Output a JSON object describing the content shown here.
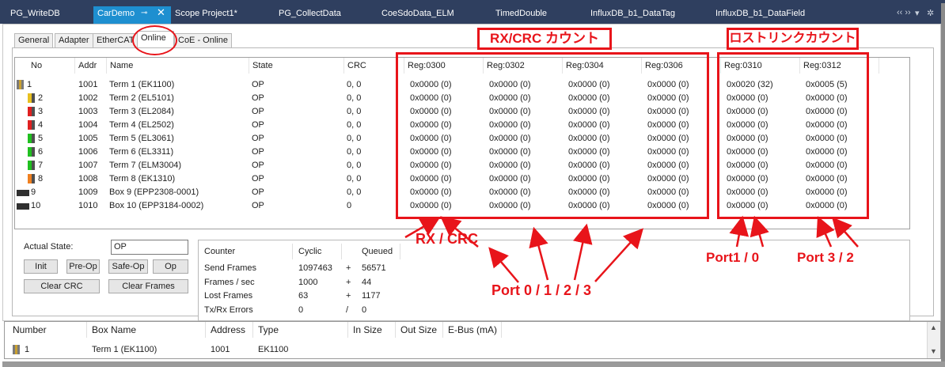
{
  "doc_tabs": [
    {
      "label": "PG_WriteDB",
      "active": false
    },
    {
      "label": "CarDemo",
      "active": true
    },
    {
      "label": "Scope Project1*",
      "active": false
    },
    {
      "label": "PG_CollectData",
      "active": false
    },
    {
      "label": "CoeSdoData_ELM",
      "active": false
    },
    {
      "label": "TimedDouble",
      "active": false
    },
    {
      "label": "InfluxDB_b1_DataTag",
      "active": false
    },
    {
      "label": "InfluxDB_b1_DataField",
      "active": false
    }
  ],
  "tab_controls": {
    "pin_glyph": "⊸",
    "close_glyph": "✕",
    "scroll_glyph": "‹‹ ››",
    "menu_glyph": "▾",
    "settings_glyph": "✲"
  },
  "sub_tabs": [
    "General",
    "Adapter",
    "EtherCAT",
    "Online",
    "CoE - Online"
  ],
  "selected_sub_tab": "Online",
  "grid": {
    "columns": [
      "No",
      "Addr",
      "Name",
      "State",
      "CRC",
      "Reg:0300",
      "Reg:0302",
      "Reg:0304",
      "Reg:0306",
      "Reg:0310",
      "Reg:0312"
    ],
    "rows": [
      {
        "no": "1",
        "addr": "1001",
        "name": "Term 1 (EK1100)",
        "state": "OP",
        "crc": "0, 0",
        "r0300": "0x0000 (0)",
        "r0302": "0x0000 (0)",
        "r0304": "0x0000 (0)",
        "r0306": "0x0000 (0)",
        "r0310": "0x0020 (32)",
        "r0312": "0x0005 (5)",
        "icon": "coupler-icon"
      },
      {
        "no": "2",
        "addr": "1002",
        "name": "Term 2 (EL5101)",
        "state": "OP",
        "crc": "0, 0",
        "r0300": "0x0000 (0)",
        "r0302": "0x0000 (0)",
        "r0304": "0x0000 (0)",
        "r0306": "0x0000 (0)",
        "r0310": "0x0000 (0)",
        "r0312": "0x0000 (0)",
        "icon": "terminal-yellow-icon"
      },
      {
        "no": "3",
        "addr": "1003",
        "name": "Term 3 (EL2084)",
        "state": "OP",
        "crc": "0, 0",
        "r0300": "0x0000 (0)",
        "r0302": "0x0000 (0)",
        "r0304": "0x0000 (0)",
        "r0306": "0x0000 (0)",
        "r0310": "0x0000 (0)",
        "r0312": "0x0000 (0)",
        "icon": "terminal-red-icon"
      },
      {
        "no": "4",
        "addr": "1004",
        "name": "Term 4 (EL2502)",
        "state": "OP",
        "crc": "0, 0",
        "r0300": "0x0000 (0)",
        "r0302": "0x0000 (0)",
        "r0304": "0x0000 (0)",
        "r0306": "0x0000 (0)",
        "r0310": "0x0000 (0)",
        "r0312": "0x0000 (0)",
        "icon": "terminal-red-icon"
      },
      {
        "no": "5",
        "addr": "1005",
        "name": "Term 5 (EL3061)",
        "state": "OP",
        "crc": "0, 0",
        "r0300": "0x0000 (0)",
        "r0302": "0x0000 (0)",
        "r0304": "0x0000 (0)",
        "r0306": "0x0000 (0)",
        "r0310": "0x0000 (0)",
        "r0312": "0x0000 (0)",
        "icon": "terminal-green-icon"
      },
      {
        "no": "6",
        "addr": "1006",
        "name": "Term 6 (EL3311)",
        "state": "OP",
        "crc": "0, 0",
        "r0300": "0x0000 (0)",
        "r0302": "0x0000 (0)",
        "r0304": "0x0000 (0)",
        "r0306": "0x0000 (0)",
        "r0310": "0x0000 (0)",
        "r0312": "0x0000 (0)",
        "icon": "terminal-green-icon"
      },
      {
        "no": "7",
        "addr": "1007",
        "name": "Term 7 (ELM3004)",
        "state": "OP",
        "crc": "0, 0",
        "r0300": "0x0000 (0)",
        "r0302": "0x0000 (0)",
        "r0304": "0x0000 (0)",
        "r0306": "0x0000 (0)",
        "r0310": "0x0000 (0)",
        "r0312": "0x0000 (0)",
        "icon": "terminal-green-icon"
      },
      {
        "no": "8",
        "addr": "1008",
        "name": "Term 8 (EK1310)",
        "state": "OP",
        "crc": "0, 0",
        "r0300": "0x0000 (0)",
        "r0302": "0x0000 (0)",
        "r0304": "0x0000 (0)",
        "r0306": "0x0000 (0)",
        "r0310": "0x0000 (0)",
        "r0312": "0x0000 (0)",
        "icon": "terminal-orange-icon"
      },
      {
        "no": "9",
        "addr": "1009",
        "name": "Box 9 (EPP2308-0001)",
        "state": "OP",
        "crc": "0, 0",
        "r0300": "0x0000 (0)",
        "r0302": "0x0000 (0)",
        "r0304": "0x0000 (0)",
        "r0306": "0x0000 (0)",
        "r0310": "0x0000 (0)",
        "r0312": "0x0000 (0)",
        "icon": "box-icon"
      },
      {
        "no": "10",
        "addr": "1010",
        "name": "Box 10 (EPP3184-0002)",
        "state": "OP",
        "crc": "0",
        "r0300": "0x0000 (0)",
        "r0302": "0x0000 (0)",
        "r0304": "0x0000 (0)",
        "r0306": "0x0000 (0)",
        "r0310": "0x0000 (0)",
        "r0312": "0x0000 (0)",
        "icon": "box-icon"
      }
    ]
  },
  "state_panel": {
    "actual_state_label": "Actual State:",
    "actual_state_value": "OP",
    "buttons": {
      "init": "Init",
      "preop": "Pre-Op",
      "safeop": "Safe-Op",
      "op": "Op",
      "clear_crc": "Clear CRC",
      "clear_frames": "Clear Frames"
    }
  },
  "counters": {
    "headers": {
      "counter": "Counter",
      "cyclic": "Cyclic",
      "queued": "Queued"
    },
    "rows": [
      {
        "label": "Send Frames",
        "cyclic": "1097463",
        "op": "+",
        "queued": "56571"
      },
      {
        "label": "Frames / sec",
        "cyclic": "1000",
        "op": "+",
        "queued": "44"
      },
      {
        "label": "Lost Frames",
        "cyclic": "63",
        "op": "+",
        "queued": "1177"
      },
      {
        "label": "Tx/Rx Errors",
        "cyclic": "0",
        "op": "/",
        "queued": "0"
      }
    ]
  },
  "bottom_list": {
    "columns": [
      "Number",
      "Box Name",
      "Address",
      "Type",
      "In Size",
      "Out Size",
      "E-Bus (mA)"
    ],
    "rows": [
      {
        "number": "1",
        "box_name": "Term 1 (EK1100)",
        "address": "1001",
        "type": "EK1100",
        "in_size": "",
        "out_size": "",
        "ebus": ""
      }
    ],
    "scroll_up": "▲",
    "scroll_down": "▼"
  },
  "annotations": {
    "rx_crc_count": "RX/CRC カウント",
    "lost_link_count": "ロストリンクカウント",
    "rx_crc": "RX / CRC",
    "port_0123": "Port 0 / 1 / 2 / 3",
    "port_10": "Port1 / 0",
    "port_32": "Port 3 / 2",
    "accent_color": "#e8141a"
  }
}
